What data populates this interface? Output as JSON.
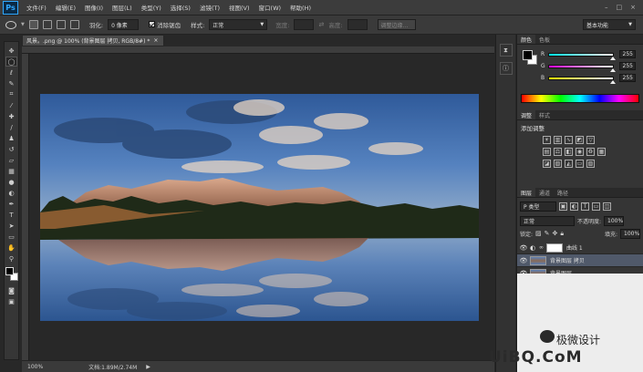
{
  "app": {
    "logo": "Ps"
  },
  "menu": [
    "文件(F)",
    "编辑(E)",
    "图像(I)",
    "图层(L)",
    "类型(Y)",
    "选择(S)",
    "滤镜(T)",
    "视图(V)",
    "窗口(W)",
    "帮助(H)"
  ],
  "window_controls": [
    "–",
    "□",
    "×"
  ],
  "options": {
    "feather_label": "羽化:",
    "feather_value": "0 像素",
    "antialias_label": "消除锯齿",
    "style_label": "样式:",
    "style_value": "正常",
    "width_label": "宽度:",
    "height_label": "高度:",
    "refine_button": "调整边缘...",
    "workspace": "基本功能"
  },
  "document": {
    "tab_title": "风景。.png @ 100% (背景图层 拷贝, RGB/8#) *",
    "tab_close": "×",
    "zoom": "100%",
    "doc_info": "文档:1.89M/2.74M"
  },
  "color_panel": {
    "tabs": [
      "颜色",
      "色板"
    ],
    "channels": [
      {
        "label": "R",
        "value": "255"
      },
      {
        "label": "G",
        "value": "255"
      },
      {
        "label": "B",
        "value": "255"
      }
    ]
  },
  "adjust_panel": {
    "tabs": [
      "调整",
      "样式"
    ],
    "title": "添加调整"
  },
  "layers_panel": {
    "tabs": [
      "图层",
      "通道",
      "路径"
    ],
    "kind_filter": "P 类型",
    "blend_mode": "正常",
    "opacity_label": "不透明度:",
    "opacity_value": "100%",
    "lock_label": "锁定:",
    "fill_label": "填充:",
    "fill_value": "100%",
    "layers": [
      {
        "name": "曲线 1",
        "selected": false
      },
      {
        "name": "背景图层 拷贝",
        "selected": true
      },
      {
        "name": "背景图层",
        "selected": false
      }
    ]
  },
  "watermark": {
    "text": "极微设计",
    "logo": "UiBQ.CoM"
  },
  "colors": {
    "accent": "#31a8ff",
    "selected_layer": "#50596a"
  }
}
